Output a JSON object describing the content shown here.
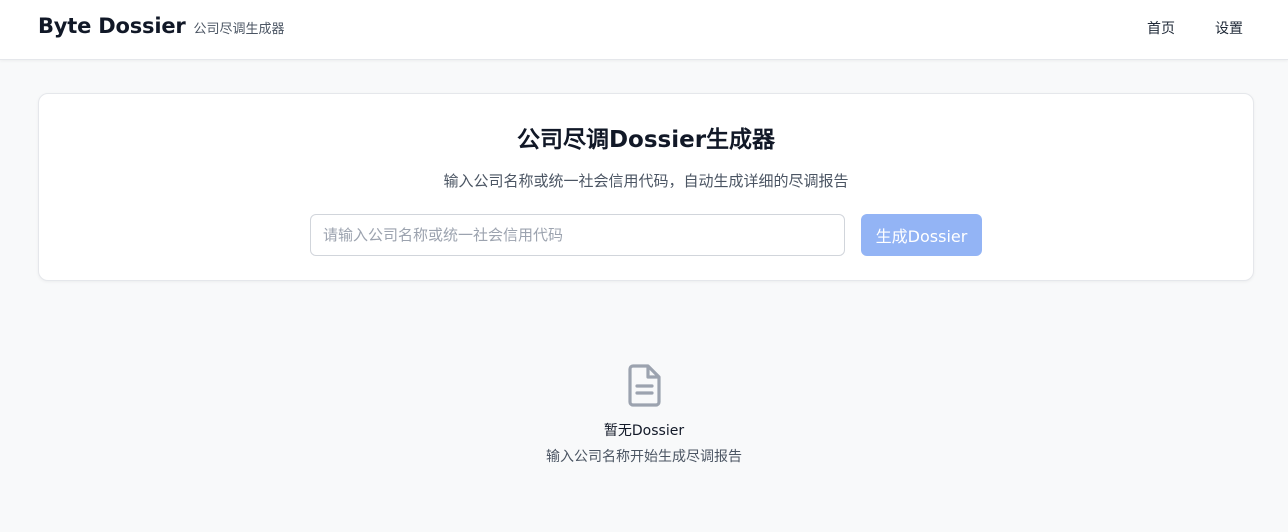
{
  "header": {
    "brand": "Byte Dossier",
    "subtitle": "公司尽调生成器",
    "nav": {
      "home": "首页",
      "settings": "设置"
    }
  },
  "main": {
    "title": "公司尽调Dossier生成器",
    "description": "输入公司名称或统一社会信用代码，自动生成详细的尽调报告",
    "search": {
      "placeholder": "请输入公司名称或统一社会信用代码",
      "value": ""
    },
    "generate_label": "生成Dossier"
  },
  "empty_state": {
    "icon": "document-icon",
    "title": "暂无Dossier",
    "description": "输入公司名称开始生成尽调报告"
  },
  "colors": {
    "accent_disabled": "#93b4f5",
    "background": "#f8f9fa",
    "icon": "#9ca3af"
  }
}
